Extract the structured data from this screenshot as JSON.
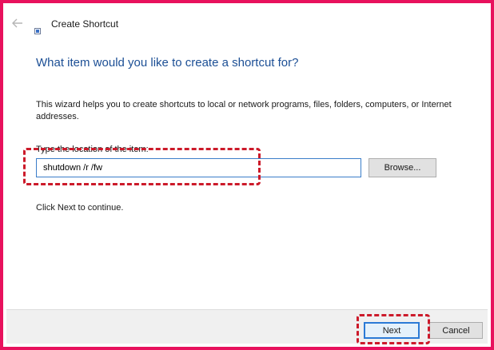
{
  "window": {
    "title": "Create Shortcut",
    "back_icon": "back-arrow-icon",
    "app_icon": "shortcut-icon"
  },
  "main": {
    "heading": "What item would you like to create a shortcut for?",
    "description": "This wizard helps you to create shortcuts to local or network programs, files, folders, computers, or Internet addresses.",
    "location_label": "Type the location of the item:",
    "location_value": "shutdown /r /fw",
    "browse_label": "Browse...",
    "continue_text": "Click Next to continue."
  },
  "footer": {
    "next_label": "Next",
    "cancel_label": "Cancel"
  },
  "colors": {
    "frame_border": "#e8115d",
    "heading": "#1c4f95",
    "highlight_dash": "#cc1a2a",
    "focus_blue": "#2b7ad6"
  }
}
